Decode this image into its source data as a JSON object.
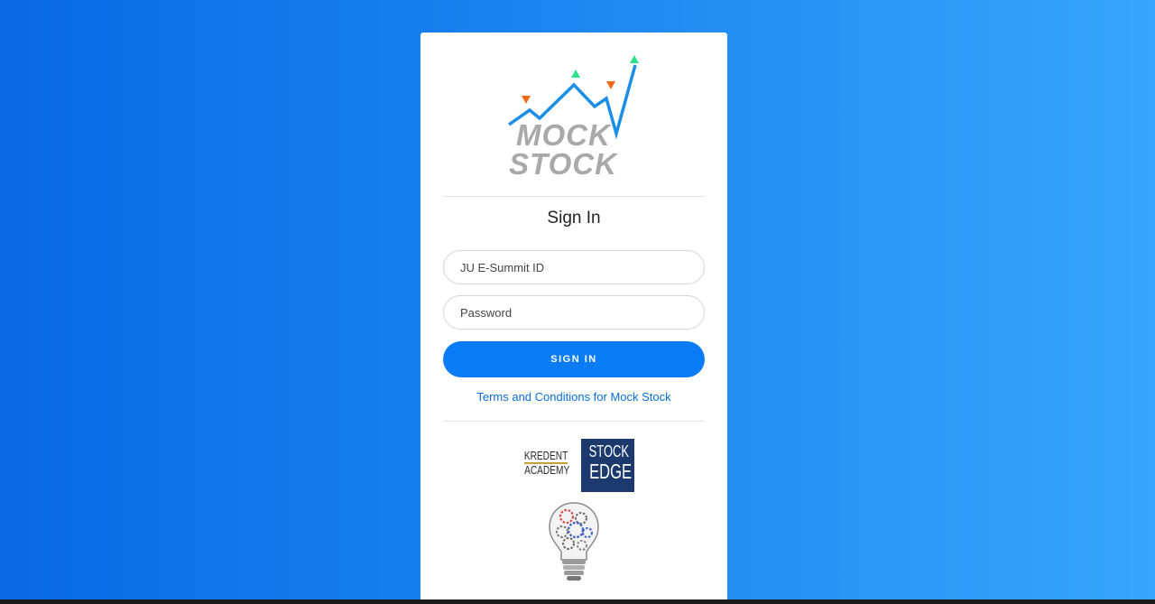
{
  "logo": {
    "line1": "MOCK",
    "line2": "STOCK",
    "icon": "stock-chart-icon"
  },
  "signin": {
    "title": "Sign In",
    "id_placeholder": "JU E-Summit ID",
    "id_value": "",
    "password_placeholder": "Password",
    "password_value": "",
    "button_label": "SIGN IN",
    "terms_link": "Terms and Conditions for Mock Stock"
  },
  "sponsors": {
    "kredent_line1": "KREDENT",
    "kredent_line2": "ACADEMY",
    "stockedge_line1": "STOCK",
    "stockedge_line2": "EDGE",
    "bulb_icon": "lightbulb-gears-icon"
  },
  "colors": {
    "accent": "#0a7cf5",
    "link": "#0a6fd8",
    "logo_text": "#a9a9a9",
    "chart_line": "#1d8ee6",
    "triangle_up": "#2ee08a",
    "triangle_down": "#f06a16",
    "stockedge_bg": "#1c3a6e"
  }
}
